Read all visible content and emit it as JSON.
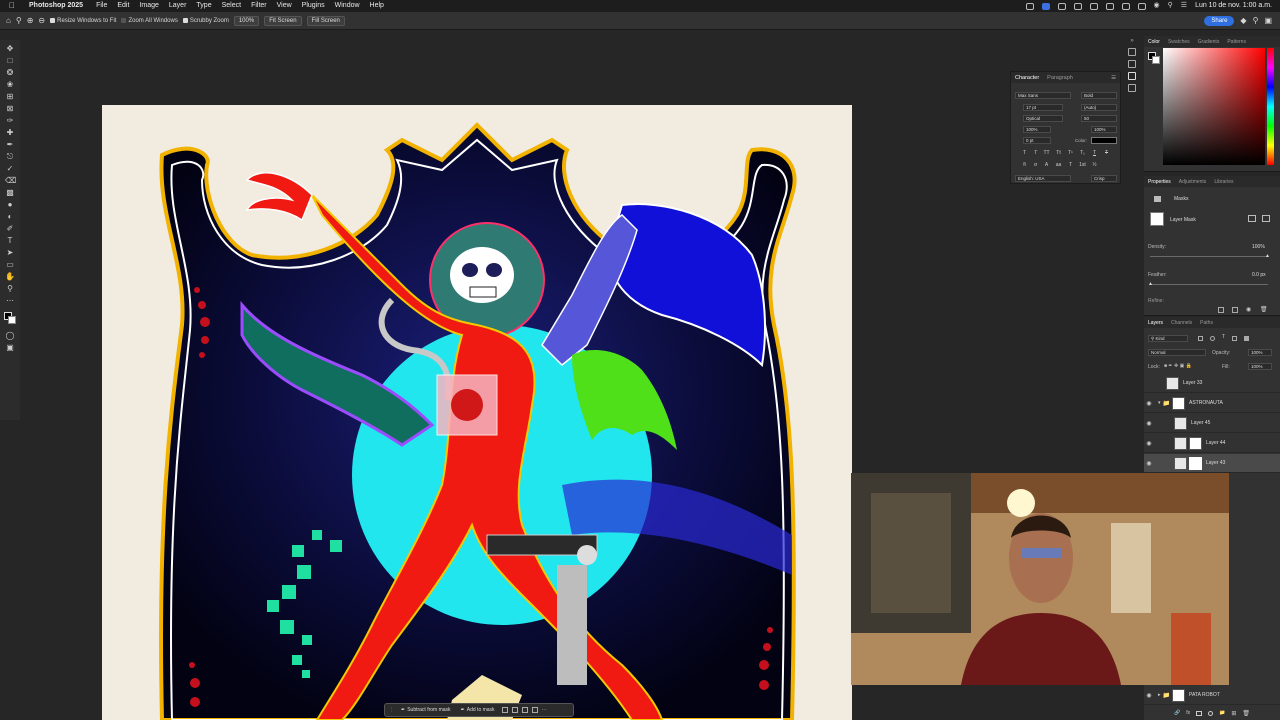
{
  "menubar": {
    "app_name": "Photoshop 2025",
    "items": [
      "File",
      "Edit",
      "Image",
      "Layer",
      "Type",
      "Select",
      "Filter",
      "View",
      "Plugins",
      "Window",
      "Help"
    ],
    "clock": "Lun 10 de nov.  1:00 a.m."
  },
  "options_bar": {
    "resize_windows": "Resize Windows to Fit",
    "zoom_all": "Zoom All Windows",
    "scrubby_zoom": "Scrubby Zoom",
    "zoom_level": "100%",
    "fit_screen": "Fit Screen",
    "fill_screen": "Fill Screen",
    "share": "Share"
  },
  "character_panel": {
    "tabs": [
      "Character",
      "Paragraph"
    ],
    "font_family": "Max Sans",
    "font_style": "Bold",
    "font_size": "17 pt",
    "leading": "(Auto)",
    "kerning": "Optical",
    "tracking": "50",
    "vertical_scale": "100%",
    "horizontal_scale": "100%",
    "baseline_shift": "0 pt",
    "color_label": "Color:",
    "language": "English: USA",
    "antialias": "Crisp"
  },
  "color_panel": {
    "tabs": [
      "Color",
      "Swatches",
      "Gradients",
      "Patterns"
    ]
  },
  "properties_panel": {
    "tabs": [
      "Properties",
      "Adjustments",
      "Libraries"
    ],
    "section": "Masks",
    "mask_type": "Layer Mask",
    "density_label": "Density:",
    "density_value": "100%",
    "density_level": 1.0,
    "feather_label": "Feather:",
    "feather_value": "0.0 px",
    "feather_level": 0.0,
    "refine_label": "Refine:"
  },
  "layers_panel": {
    "tabs": [
      "Layers",
      "Channels",
      "Paths"
    ],
    "filter_kind": "Kind",
    "blend_mode": "Normal",
    "opacity_label": "Opacity:",
    "opacity_value": "100%",
    "lock_label": "Lock:",
    "fill_label": "Fill:",
    "fill_value": "100%",
    "layers": [
      {
        "name": "Layer 33",
        "visible": false
      },
      {
        "name": "ASTRONAUTA",
        "visible": true
      },
      {
        "name": "Layer 45",
        "visible": true
      },
      {
        "name": "Layer 44",
        "visible": true
      },
      {
        "name": "Layer 43",
        "visible": true
      }
    ],
    "bottom_layer": "PATA ROBOT"
  },
  "mask_bar": {
    "subtract": "Subtract from mask",
    "add": "Add to mask"
  },
  "colors": {
    "accent": "#2f6fe0",
    "panel_bg": "#323232",
    "canvas_bg": "#262626",
    "paper": "#f1ebe0"
  }
}
